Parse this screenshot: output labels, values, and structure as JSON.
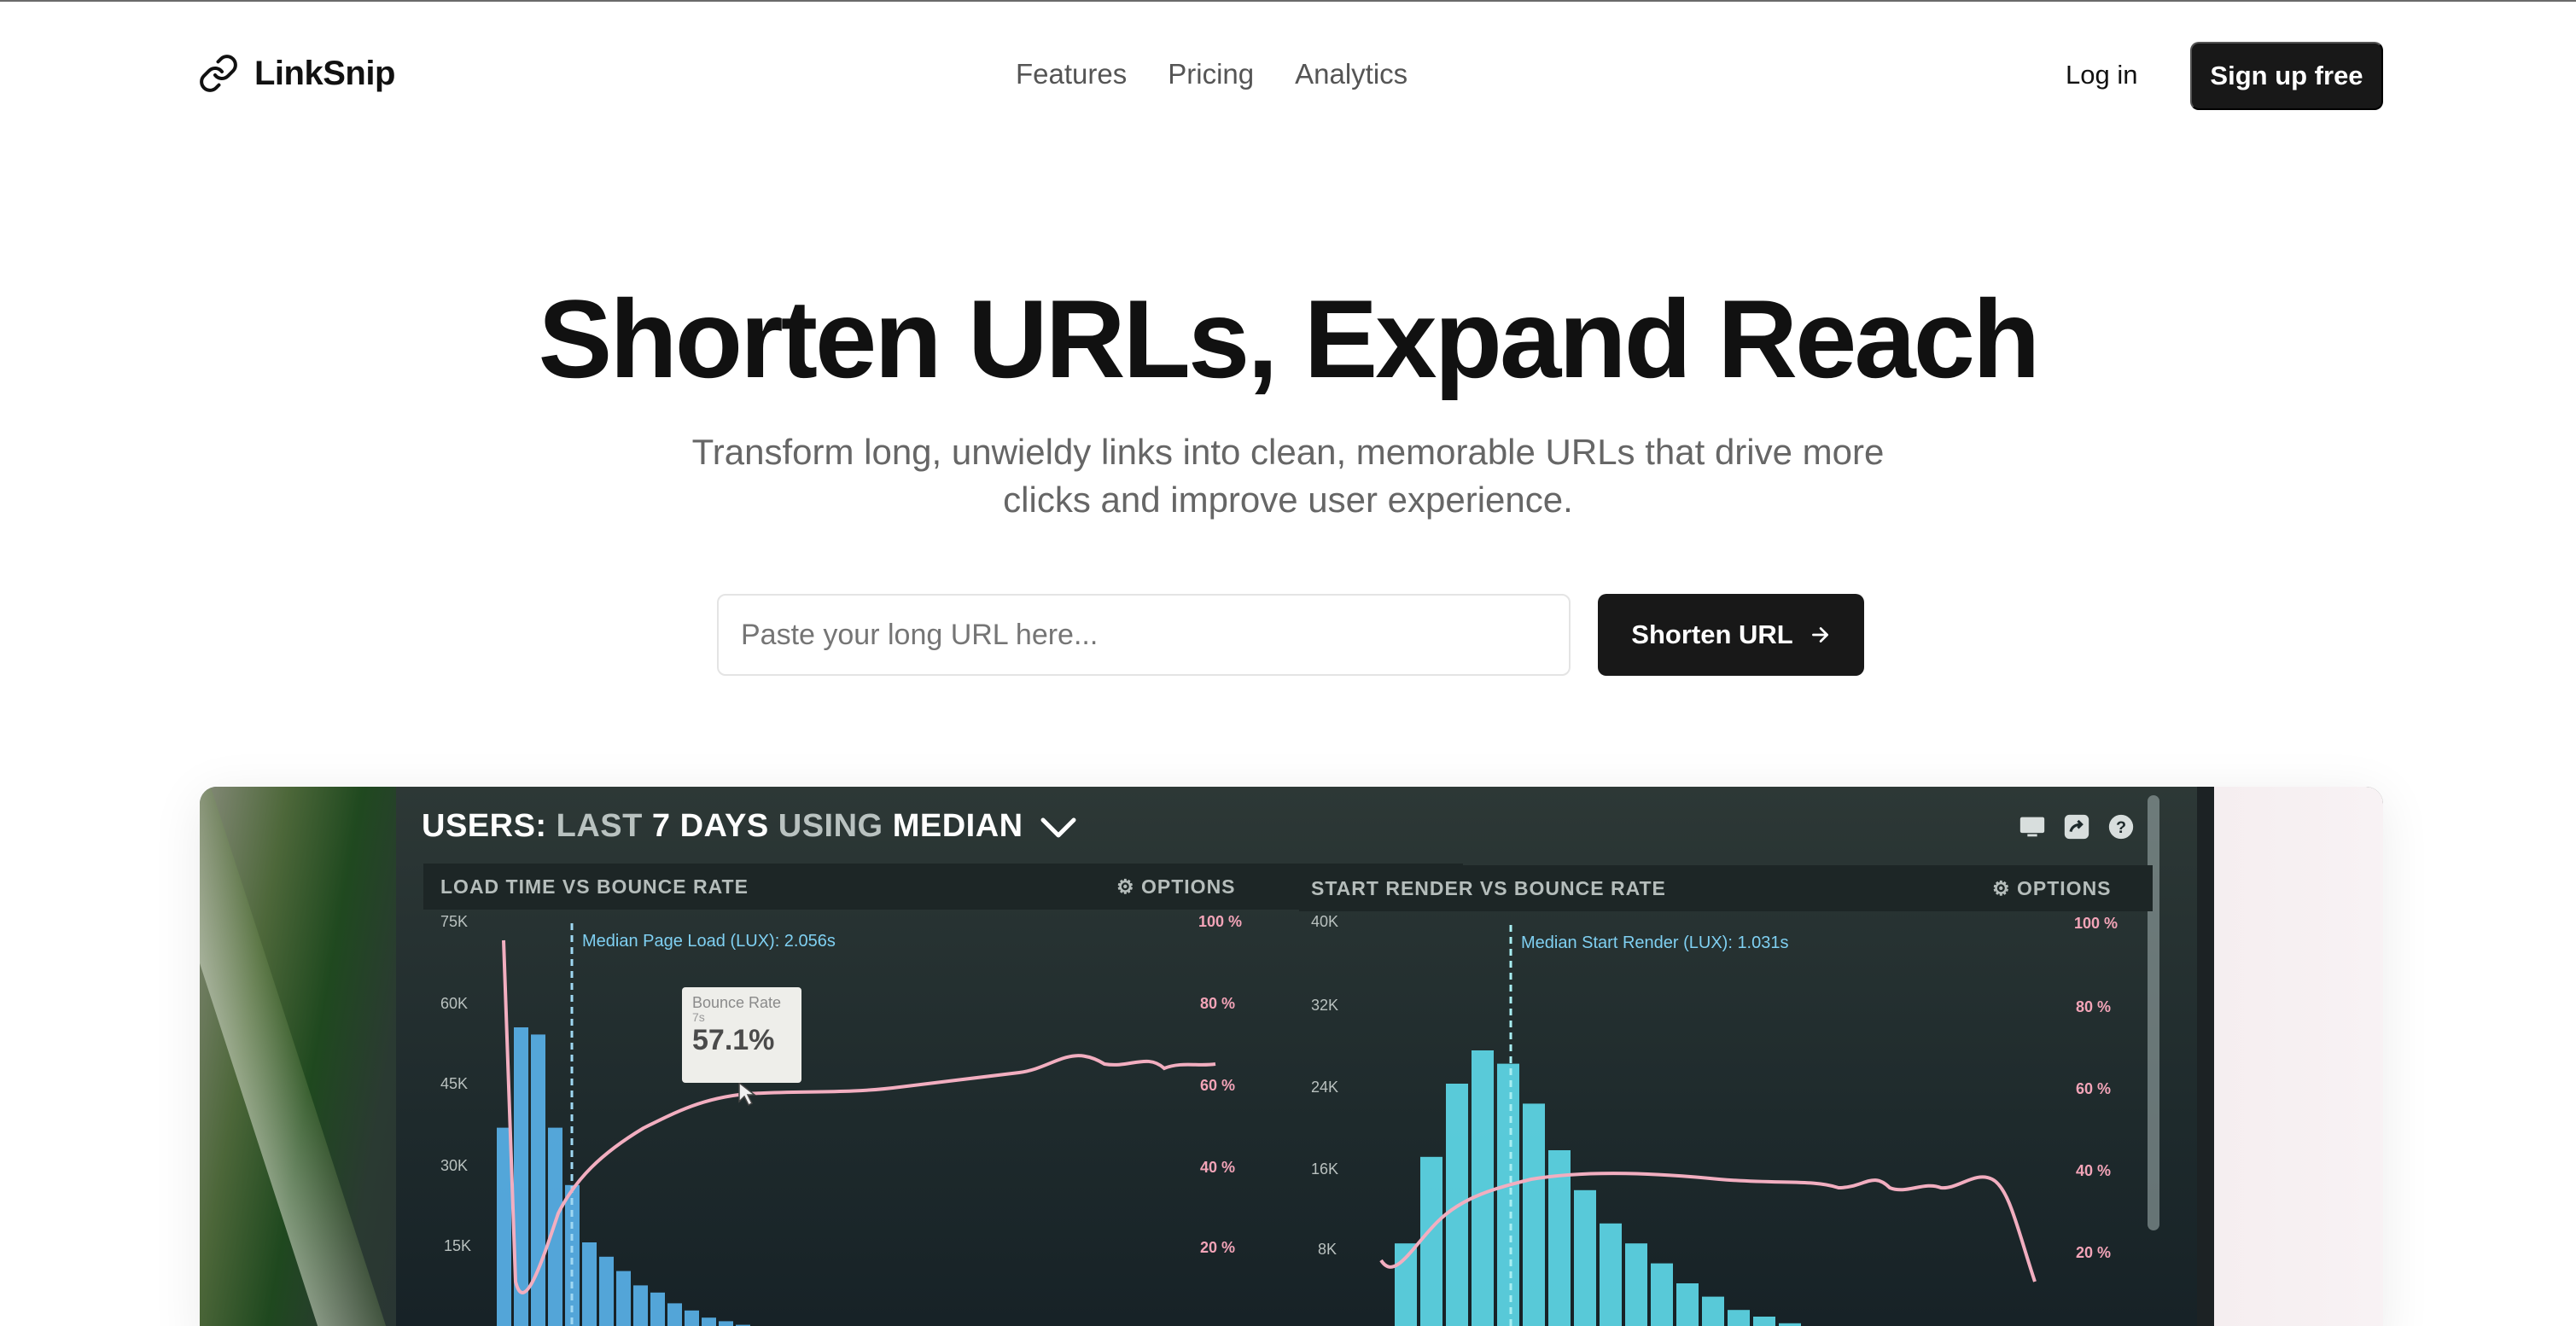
{
  "brand": {
    "name": "LinkSnip",
    "logo_icon": "link-icon"
  },
  "nav": {
    "items": [
      "Features",
      "Pricing",
      "Analytics"
    ]
  },
  "auth": {
    "login_label": "Log in",
    "signup_label": "Sign up free"
  },
  "hero": {
    "title": "Shorten URLs, Expand Reach",
    "subtitle": "Transform long, unwieldy links into clean, memorable URLs that drive more clicks and improve user experience.",
    "input_placeholder": "Paste your long URL here...",
    "input_value": "",
    "button_label": "Shorten URL",
    "button_icon": "arrow-right-icon"
  },
  "preview": {
    "dashboard_title_parts": [
      "USERS:",
      "LAST",
      "7 DAYS",
      "USING",
      "MEDIAN"
    ],
    "icons": [
      "monitor-icon",
      "share-icon",
      "help-icon"
    ],
    "left_panel": {
      "title": "LOAD TIME VS BOUNCE RATE",
      "options": "OPTIONS",
      "median_label": "Median Page Load (LUX): 2.056s",
      "y_left_ticks": [
        "75K",
        "60K",
        "45K",
        "30K",
        "15K"
      ],
      "y_right_ticks": [
        "100 %",
        "80 %",
        "60 %",
        "40 %",
        "20 %"
      ],
      "tooltip": {
        "label": "Bounce Rate",
        "sub": "7s",
        "value": "57.1%"
      }
    },
    "right_panel": {
      "title": "START RENDER VS BOUNCE RATE",
      "options": "OPTIONS",
      "median_label": "Median Start Render (LUX): 1.031s",
      "y_left_ticks": [
        "40K",
        "32K",
        "24K",
        "16K",
        "8K"
      ],
      "y_right_ticks": [
        "100 %",
        "80 %",
        "60 %",
        "40 %",
        "20 %"
      ]
    },
    "colors": {
      "left_bars": "#5ab4ec",
      "right_bars": "#5fdcec",
      "line": "#f2aec0"
    }
  }
}
